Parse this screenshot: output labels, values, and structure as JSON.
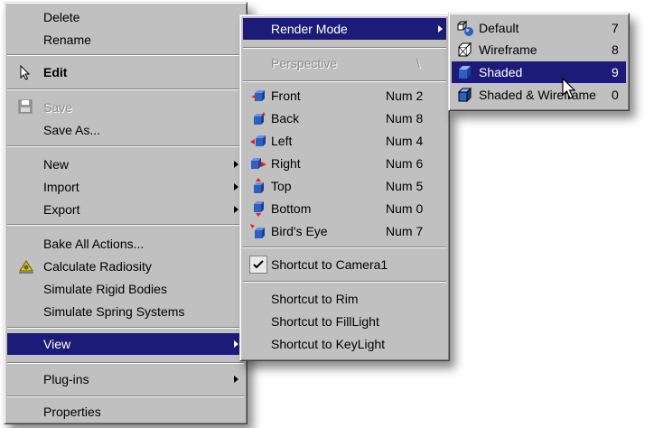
{
  "main_menu": {
    "delete": "Delete",
    "rename": "Rename",
    "edit": "Edit",
    "save": "Save",
    "save_as": "Save As...",
    "new": "New",
    "import": "Import",
    "export": "Export",
    "bake_all_actions": "Bake All Actions...",
    "calculate_radiosity": "Calculate Radiosity",
    "simulate_rigid_bodies": "Simulate Rigid Bodies",
    "simulate_spring_systems": "Simulate Spring Systems",
    "view": "View",
    "plug_ins": "Plug-ins",
    "properties": "Properties"
  },
  "view_menu": {
    "render_mode": "Render Mode",
    "perspective": {
      "label": "Perspective",
      "shortcut": "\\"
    },
    "views": [
      {
        "label": "Front",
        "shortcut": "Num 2"
      },
      {
        "label": "Back",
        "shortcut": "Num 8"
      },
      {
        "label": "Left",
        "shortcut": "Num 4"
      },
      {
        "label": "Right",
        "shortcut": "Num 6"
      },
      {
        "label": "Top",
        "shortcut": "Num 5"
      },
      {
        "label": "Bottom",
        "shortcut": "Num 0"
      },
      {
        "label": "Bird's Eye",
        "shortcut": "Num 7"
      }
    ],
    "shortcut_camera1": "Shortcut to Camera1",
    "shortcut_rim": "Shortcut to Rim",
    "shortcut_filllight": "Shortcut to FillLight",
    "shortcut_keylight": "Shortcut to KeyLight"
  },
  "render_menu": {
    "items": [
      {
        "label": "Default",
        "shortcut": "7"
      },
      {
        "label": "Wireframe",
        "shortcut": "8"
      },
      {
        "label": "Shaded",
        "shortcut": "9"
      },
      {
        "label": "Shaded & Wireframe",
        "shortcut": "0"
      }
    ]
  },
  "colors": {
    "menu_bg": "#c0c0c0",
    "highlight": "#1c1c78",
    "highlight_text": "#ffffff",
    "disabled_text": "#8a8a8a",
    "cube_blue": "#2f5fc0",
    "arrow_red": "#e02020"
  }
}
